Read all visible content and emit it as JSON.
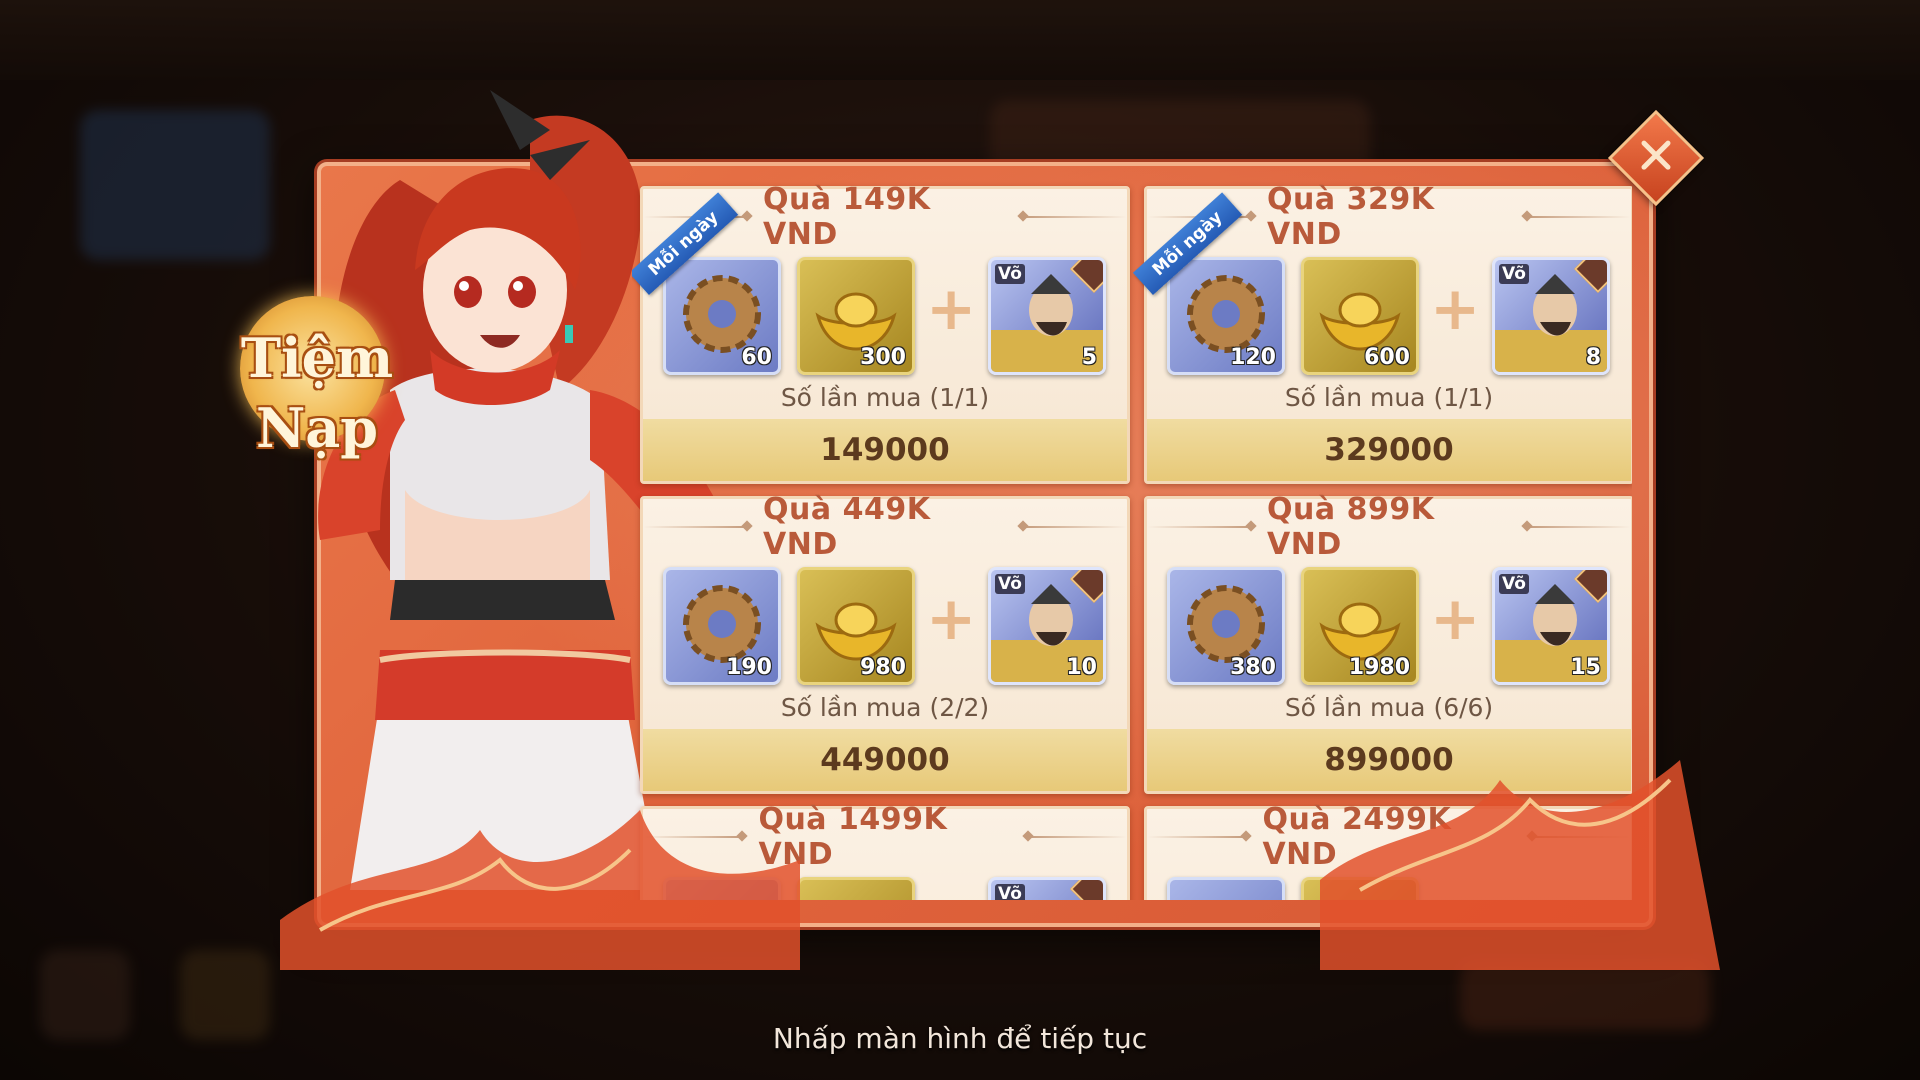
{
  "shop": {
    "title_line1": "Tiệm",
    "title_line2": "Nạp"
  },
  "packs": [
    {
      "title": "Quà 149K VND",
      "ribbon": "Mỗi ngày",
      "gear_qty": "60",
      "gold_qty": "300",
      "hero_tag": "Võ",
      "hero_qty": "5",
      "purchase": "Số lần mua (1/1)",
      "price": "149000"
    },
    {
      "title": "Quà 329K VND",
      "ribbon": "Mỗi ngày",
      "gear_qty": "120",
      "gold_qty": "600",
      "hero_tag": "Võ",
      "hero_qty": "8",
      "purchase": "Số lần mua (1/1)",
      "price": "329000"
    },
    {
      "title": "Quà 449K VND",
      "gear_qty": "190",
      "gold_qty": "980",
      "hero_tag": "Võ",
      "hero_qty": "10",
      "purchase": "Số lần mua (2/2)",
      "price": "449000"
    },
    {
      "title": "Quà 899K VND",
      "gear_qty": "380",
      "gold_qty": "1980",
      "hero_tag": "Võ",
      "hero_qty": "15",
      "purchase": "Số lần mua (6/6)",
      "price": "899000"
    },
    {
      "title": "Quà 1499K VND",
      "hero_tag": "Võ"
    },
    {
      "title": "Quà 2499K VND"
    }
  ],
  "footer": {
    "continue_hint": "Nhấp màn hình để tiếp tục"
  },
  "icons": {
    "close": "close-icon",
    "gear": "gear-icon",
    "gold": "gold-ingot-icon",
    "hero": "hero-portrait-icon"
  },
  "colors": {
    "modal": "#e0643c",
    "card": "#f8ecdc",
    "price_bar": "#ecd38c",
    "title_text": "#b95a3a",
    "ribbon": "#2f6fcf"
  }
}
